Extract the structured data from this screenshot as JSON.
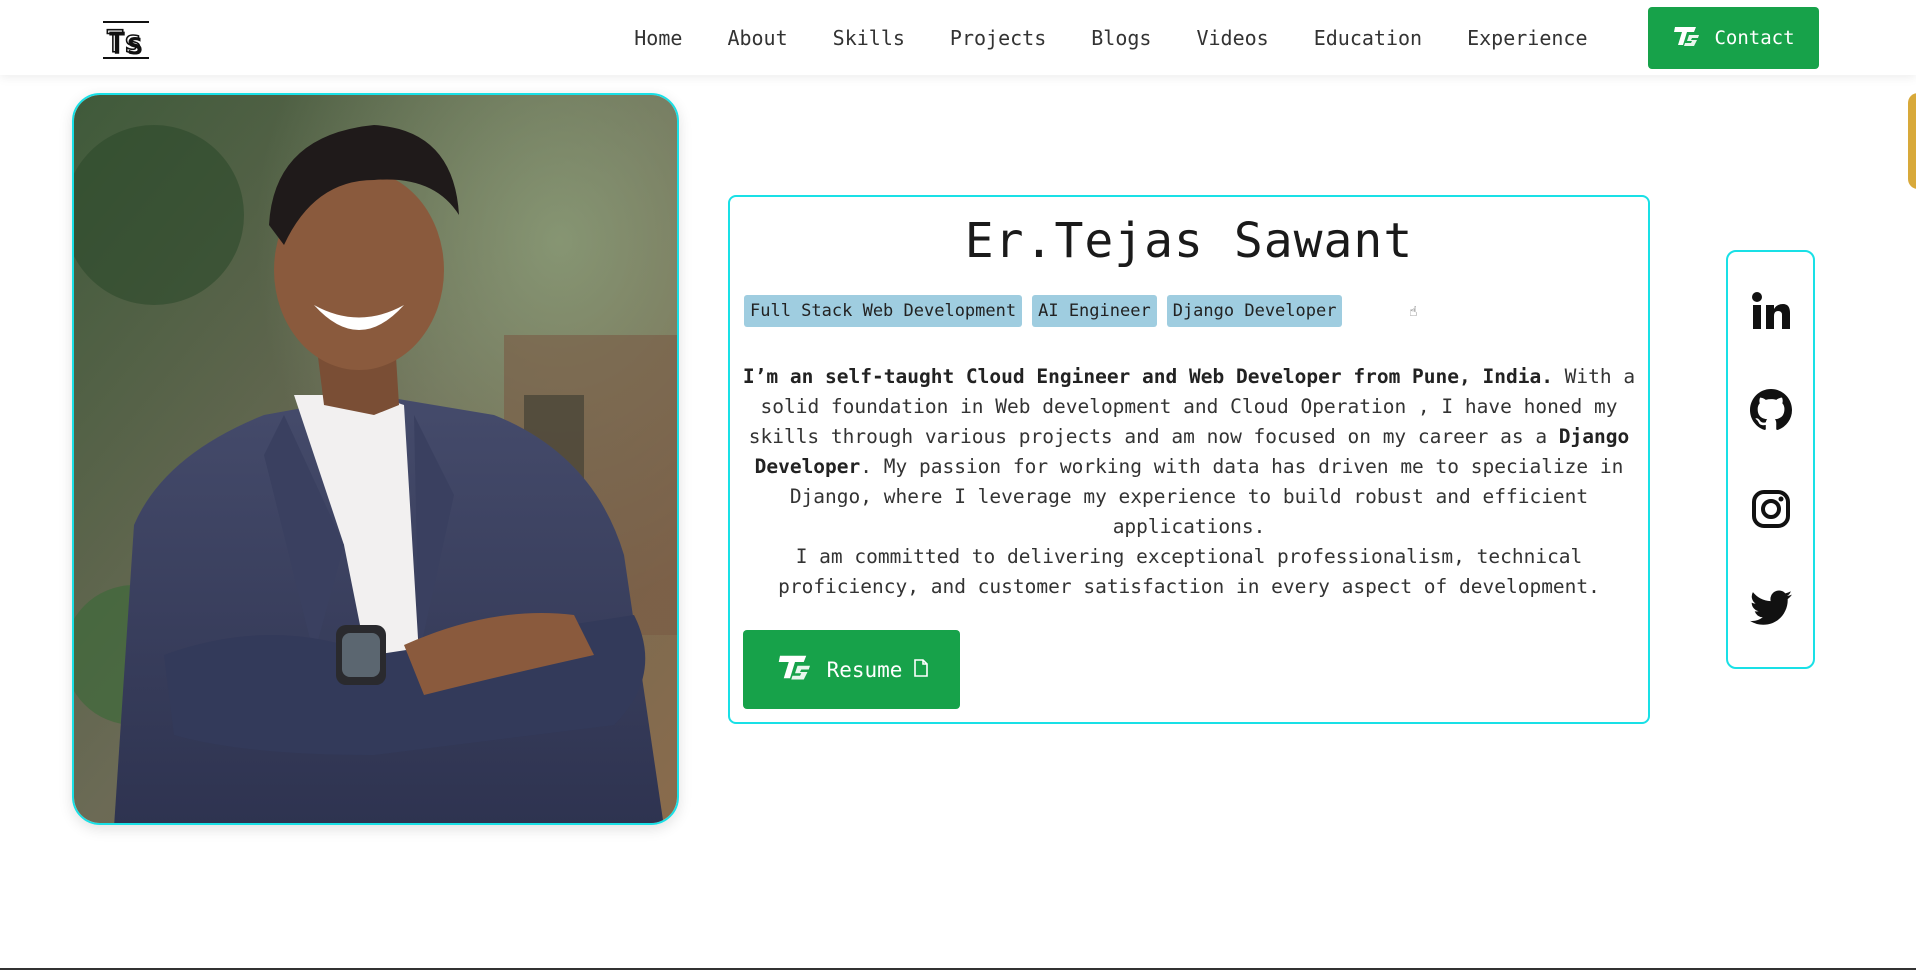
{
  "logo": {
    "text": "Ts"
  },
  "nav": {
    "items": [
      {
        "label": "Home"
      },
      {
        "label": "About"
      },
      {
        "label": "Skills"
      },
      {
        "label": "Projects"
      },
      {
        "label": "Blogs"
      },
      {
        "label": "Videos"
      },
      {
        "label": "Education"
      },
      {
        "label": "Experience"
      }
    ],
    "contact_label": "Contact"
  },
  "hero": {
    "name": "Er.Tejas Sawant",
    "tags": [
      "Full Stack Web Development",
      "AI Engineer",
      "Django Developer"
    ],
    "bio_intro": "I’m an self-taught Cloud Engineer and Web Developer from Pune, India.",
    "bio_part1": " With a solid foundation in Web development and Cloud Operation , I have honed my skills through various projects and am now focused on my career as a ",
    "bio_role": "Django Developer",
    "bio_part2": ". My passion for working with data has driven me to specialize in Django, where I leverage my experience to build robust and efficient applications.",
    "bio_part3": "I am committed to delivering exceptional professionalism, technical proficiency, and customer satisfaction in every aspect of development.",
    "resume_label": "Resume"
  },
  "social": {
    "icons": [
      "linkedin-icon",
      "github-icon",
      "instagram-icon",
      "twitter-icon"
    ]
  },
  "colors": {
    "accent_green": "#17a24a",
    "border_cyan": "#19e0e6",
    "tag_bg": "#9fcde0"
  }
}
